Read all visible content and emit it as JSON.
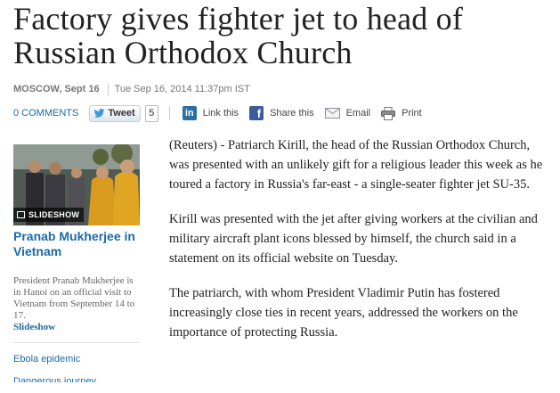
{
  "article": {
    "headline": "Factory gives fighter jet to head of Russian Orthodox Church",
    "location": "MOSCOW, Sept 16",
    "timestamp": "Tue Sep 16, 2014 11:37pm IST",
    "paragraphs": [
      "(Reuters) - Patriarch Kirill, the head of the Russian Orthodox Church, was presented with an unlikely gift for a religious leader this week as he toured a factory in Russia's far-east - a single-seater fighter jet SU-35.",
      "Kirill was presented with the jet after giving workers at the civilian and military aircraft plant icons blessed by himself, the church said in a statement on its official website on Tuesday.",
      "The patriarch, with whom President Vladimir Putin has fostered increasingly close ties in recent years, addressed the workers on the importance of protecting Russia."
    ]
  },
  "share": {
    "comments": "0 COMMENTS",
    "tweet_label": "Tweet",
    "tweet_count": "5",
    "linkedin_label": "Link this",
    "facebook_label": "Share this",
    "email_label": "Email",
    "print_label": "Print"
  },
  "sidebar": {
    "slideshow_badge": "SLIDESHOW",
    "title": "Pranab Mukherjee in Vietnam",
    "description": "President Pranab Mukherjee is in Hanoi on an official visit to Vietnam from September 14 to 17.",
    "more_link": "Slideshow",
    "links": [
      "Ebola epidemic",
      "Dangerous journey"
    ]
  },
  "colors": {
    "link": "#1a6aa8",
    "linkedin": "#2b6ea5",
    "facebook": "#3b5b99"
  }
}
